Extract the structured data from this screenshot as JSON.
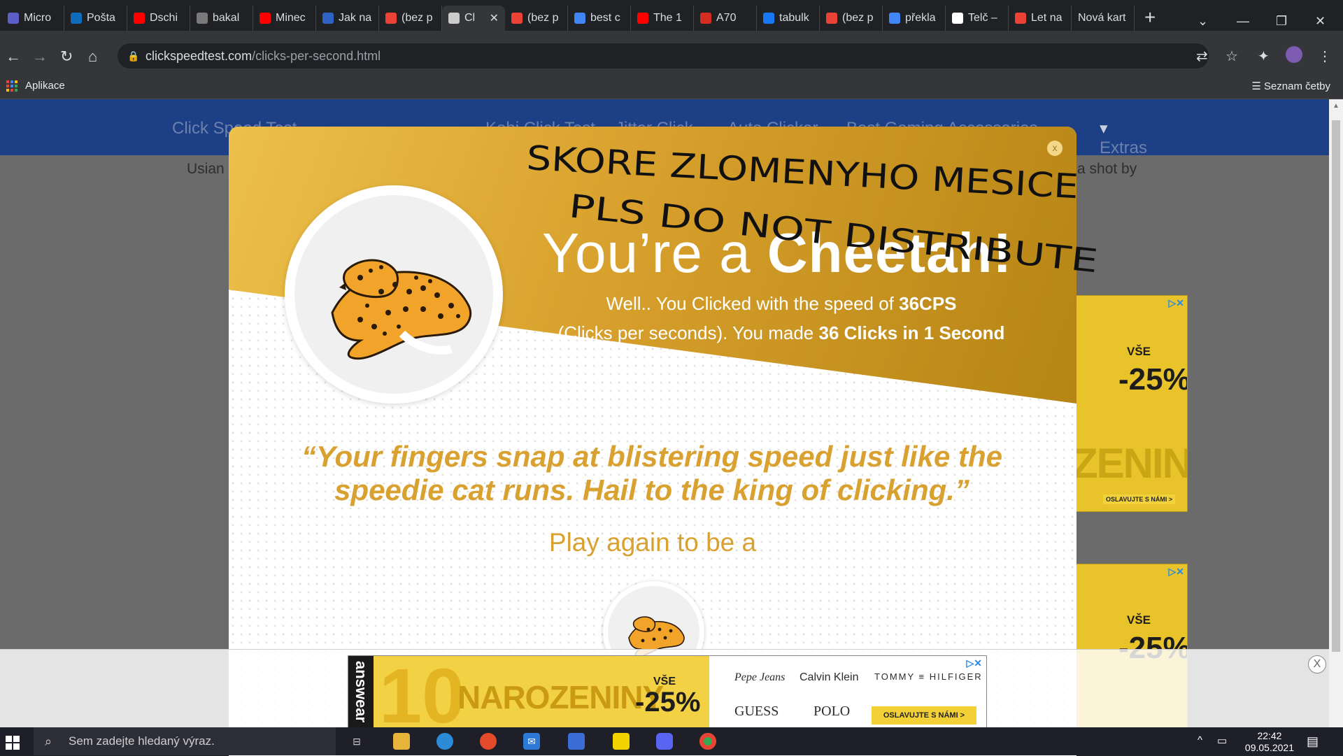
{
  "browser": {
    "tabs": [
      {
        "label": "Micro",
        "icon": "teams-icon",
        "color": "#5b5fc7"
      },
      {
        "label": "Pošta",
        "icon": "outlook-icon",
        "color": "#0f6cbd"
      },
      {
        "label": "Dschi",
        "icon": "youtube-icon",
        "color": "#ff0000"
      },
      {
        "label": "bakal",
        "icon": "globe-icon",
        "color": "#7a7a7a"
      },
      {
        "label": "Minec",
        "icon": "youtube-icon",
        "color": "#ff0000"
      },
      {
        "label": "Jak na",
        "icon": "arrow-icon",
        "color": "#2e63c4"
      },
      {
        "label": "(bez p",
        "icon": "gmail-icon",
        "color": "#ea4335"
      },
      {
        "label": "Cl",
        "icon": "cursor-icon",
        "color": "#cccccc",
        "active": true
      },
      {
        "label": "(bez p",
        "icon": "gmail-icon",
        "color": "#ea4335"
      },
      {
        "label": "best c",
        "icon": "google-icon",
        "color": "#4285f4"
      },
      {
        "label": "The 1",
        "icon": "youtube-icon",
        "color": "#ff0000"
      },
      {
        "label": "A70",
        "icon": "samsung-icon",
        "color": "#d62d20"
      },
      {
        "label": "tabulk",
        "icon": "wn-icon",
        "color": "#1877f2"
      },
      {
        "label": "(bez p",
        "icon": "gmail-icon",
        "color": "#ea4335"
      },
      {
        "label": "překla",
        "icon": "google-icon",
        "color": "#4285f4"
      },
      {
        "label": "Telč –",
        "icon": "wikipedia-icon",
        "color": "#ffffff"
      },
      {
        "label": "Let na",
        "icon": "gmail-icon",
        "color": "#ea4335"
      },
      {
        "label": "Nová kart",
        "icon": "",
        "color": ""
      }
    ],
    "url_host": "clickspeedtest.com",
    "url_path": "/clicks-per-second.html",
    "bookmarks_apps_label": "Aplikace",
    "reading_list_label": "Seznam četby"
  },
  "site": {
    "nav_items": [
      "Click Speed Test",
      "Kohi Click Test",
      "Jitter Click",
      "Auto Clicker",
      "Best Gaming Accessories",
      "Extras"
    ],
    "subline_left": "Usian E",
    "subline_right": "a shot by"
  },
  "modal": {
    "close_label": "x",
    "headline_pre": "You’re a ",
    "headline_bold": "Cheetah!",
    "result_line1_pre": "Well.. You Clicked with the speed of ",
    "result_line1_bold": "36CPS",
    "result_line2_pre": "(Clicks per seconds). You made ",
    "result_line2_bold": "36 Clicks in 1 Second",
    "quote": "“Your fingers snap at blistering speed just like the speedie cat runs. Hail to the king of clicking.”",
    "play_again": "Play again to be a",
    "gold": "#d9a130"
  },
  "graffiti": {
    "line1": "SKORE ZLOMENYHO MESICE",
    "line2": "PLS DO NOT DISTRIBUTE"
  },
  "side_ads": {
    "vse": "VŠE",
    "discount": "-25%",
    "word": "ZENINY",
    "cta": "OSLAVUJTE S NÁMI >"
  },
  "bottom_ad": {
    "brand": "answear",
    "ten": "10",
    "naro": "NAROZENINY",
    "vse": "VŠE",
    "discount": "-25%",
    "brands_top": [
      "Pepe Jeans",
      "Calvin Klein",
      "TOMMY ≡ HILFIGER"
    ],
    "brands_bottom": [
      "GUESS",
      "POLO"
    ],
    "cta": "OSLAVUJTE S NÁMI >",
    "close_label": "X"
  },
  "taskbar": {
    "search_placeholder": "Sem zadejte hledaný výraz.",
    "time": "22:42",
    "date": "09.05.2021"
  }
}
